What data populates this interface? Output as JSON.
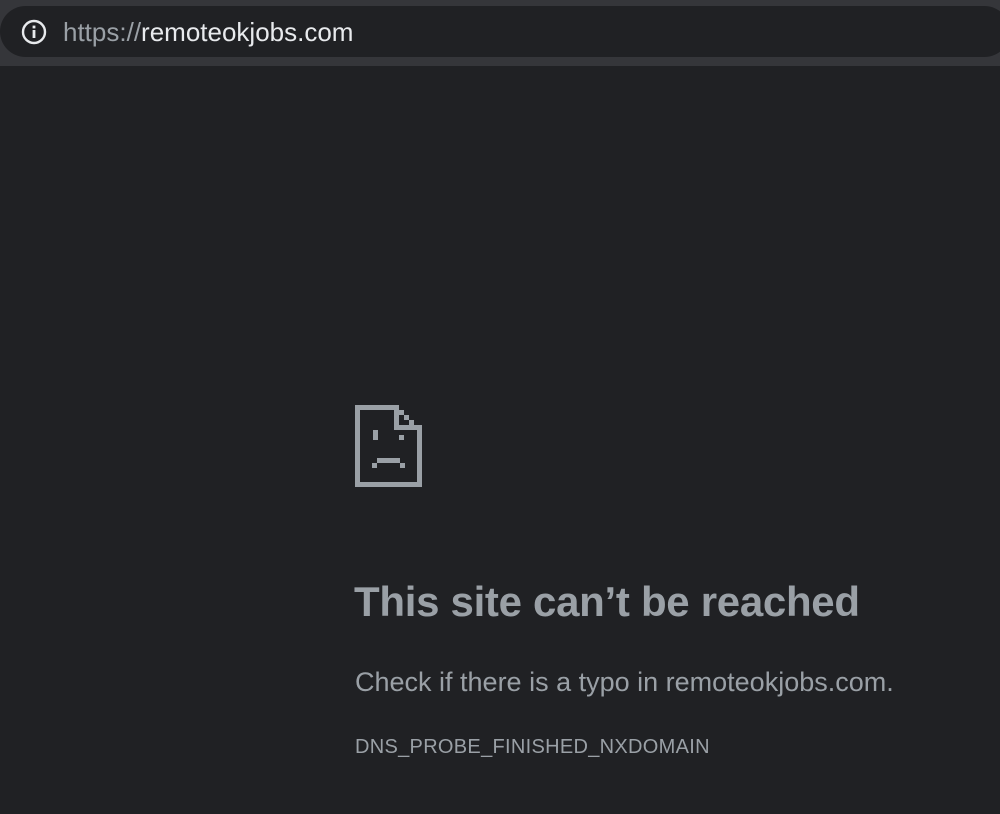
{
  "address_bar": {
    "url_scheme": "https://",
    "url_host": "remoteokjobs.com",
    "info_icon": "info-icon"
  },
  "error_page": {
    "icon": "sad-file-icon",
    "title": "This site can’t be reached",
    "description": "Check if there is a typo in remoteokjobs.com.",
    "error_code": "DNS_PROBE_FINISHED_NXDOMAIN"
  },
  "colors": {
    "page_background": "#202124",
    "toolbar_background": "#35363a",
    "text_primary": "#e8eaed",
    "text_secondary": "#9aa0a6"
  }
}
